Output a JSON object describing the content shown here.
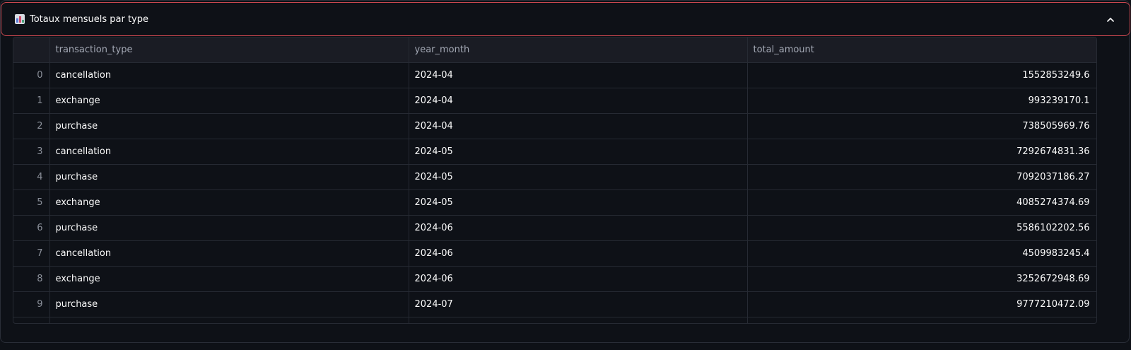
{
  "expander": {
    "title": "Totaux mensuels par type",
    "icon": "bar-chart-icon",
    "toggle_icon": "chevron-up-icon"
  },
  "table": {
    "columns": [
      "",
      "transaction_type",
      "year_month",
      "total_amount"
    ],
    "rows": [
      {
        "index": "0",
        "transaction_type": "cancellation",
        "year_month": "2024-04",
        "total_amount": "1552853249.6"
      },
      {
        "index": "1",
        "transaction_type": "exchange",
        "year_month": "2024-04",
        "total_amount": "993239170.1"
      },
      {
        "index": "2",
        "transaction_type": "purchase",
        "year_month": "2024-04",
        "total_amount": "738505969.76"
      },
      {
        "index": "3",
        "transaction_type": "cancellation",
        "year_month": "2024-05",
        "total_amount": "7292674831.36"
      },
      {
        "index": "4",
        "transaction_type": "purchase",
        "year_month": "2024-05",
        "total_amount": "7092037186.27"
      },
      {
        "index": "5",
        "transaction_type": "exchange",
        "year_month": "2024-05",
        "total_amount": "4085274374.69"
      },
      {
        "index": "6",
        "transaction_type": "purchase",
        "year_month": "2024-06",
        "total_amount": "5586102202.56"
      },
      {
        "index": "7",
        "transaction_type": "cancellation",
        "year_month": "2024-06",
        "total_amount": "4509983245.4"
      },
      {
        "index": "8",
        "transaction_type": "exchange",
        "year_month": "2024-06",
        "total_amount": "3252672948.69"
      },
      {
        "index": "9",
        "transaction_type": "purchase",
        "year_month": "2024-07",
        "total_amount": "9777210472.09"
      }
    ]
  },
  "colors": {
    "background": "#0e1117",
    "header_border": "#c9474f",
    "grid_line": "#262a33",
    "header_bg": "#1a1c24"
  }
}
